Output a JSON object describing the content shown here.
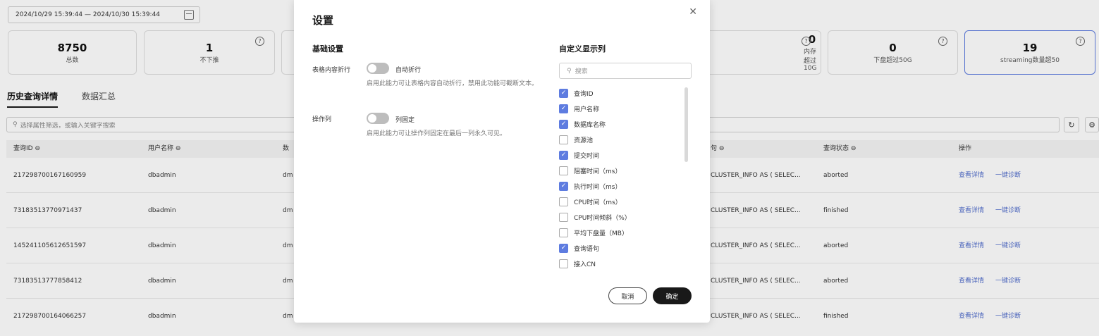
{
  "filters": {
    "date_range": "2024/10/29 15:39:44 — 2024/10/30 15:39:44"
  },
  "stats": [
    {
      "value": "8750",
      "label": "总数",
      "help": false
    },
    {
      "value": "1",
      "label": "不下推",
      "help": true
    },
    {
      "value": "0",
      "label": "内存超过10G",
      "help": true
    },
    {
      "value": "0",
      "label": "下盘超过50G",
      "help": true
    },
    {
      "value": "19",
      "label": "streaming数量超50",
      "help": true
    }
  ],
  "tabs": [
    {
      "label": "历史查询详情",
      "active": true
    },
    {
      "label": "数据汇总",
      "active": false
    }
  ],
  "search": {
    "placeholder": "选择属性筛选，或输入关键字搜索"
  },
  "table": {
    "columns": [
      "查询ID",
      "用户名称",
      "数",
      "句",
      "查询状态",
      "操作"
    ],
    "rows": [
      {
        "id": "217298700167160959",
        "user": "dbadmin",
        "db": "dm",
        "sql": "CLUSTER_INFO AS ( SELEC...",
        "status": "aborted"
      },
      {
        "id": "73183513770971437",
        "user": "dbadmin",
        "db": "dm",
        "sql": "CLUSTER_INFO AS ( SELEC...",
        "status": "finished"
      },
      {
        "id": "145241105612651597",
        "user": "dbadmin",
        "db": "dm",
        "sql": "CLUSTER_INFO AS ( SELEC...",
        "status": "aborted"
      },
      {
        "id": "73183513777858412",
        "user": "dbadmin",
        "db": "dm",
        "sql": "CLUSTER_INFO AS ( SELEC...",
        "status": "aborted"
      },
      {
        "id": "217298700164066257",
        "user": "dbadmin",
        "db": "dm",
        "sql": "CLUSTER_INFO AS ( SELEC...",
        "status": "finished"
      }
    ],
    "action_view": "查看详情",
    "action_diagnose": "一键诊断"
  },
  "dialog": {
    "title": "设置",
    "basic_title": "基础设置",
    "wrap_label": "表格内容折行",
    "wrap_toggle_text": "自动折行",
    "wrap_desc": "启用此能力可让表格内容自动折行，禁用此功能可截断文本。",
    "op_label": "操作列",
    "op_toggle_text": "列固定",
    "op_desc": "启用此能力可让操作列固定在最后一列永久可见。",
    "columns_title": "自定义显示列",
    "columns_search_placeholder": "搜索",
    "columns": [
      {
        "label": "查询ID",
        "checked": true
      },
      {
        "label": "用户名称",
        "checked": true
      },
      {
        "label": "数据库名称",
        "checked": true
      },
      {
        "label": "资源池",
        "checked": false
      },
      {
        "label": "提交时间",
        "checked": true
      },
      {
        "label": "阻塞时间（ms）",
        "checked": false
      },
      {
        "label": "执行时间（ms）",
        "checked": true
      },
      {
        "label": "CPU时间（ms）",
        "checked": false
      },
      {
        "label": "CPU时间倾斜（%）",
        "checked": false
      },
      {
        "label": "平均下盘量（MB）",
        "checked": false
      },
      {
        "label": "查询语句",
        "checked": true
      },
      {
        "label": "接入CN",
        "checked": false
      }
    ],
    "cancel_label": "取消",
    "ok_label": "确定"
  }
}
